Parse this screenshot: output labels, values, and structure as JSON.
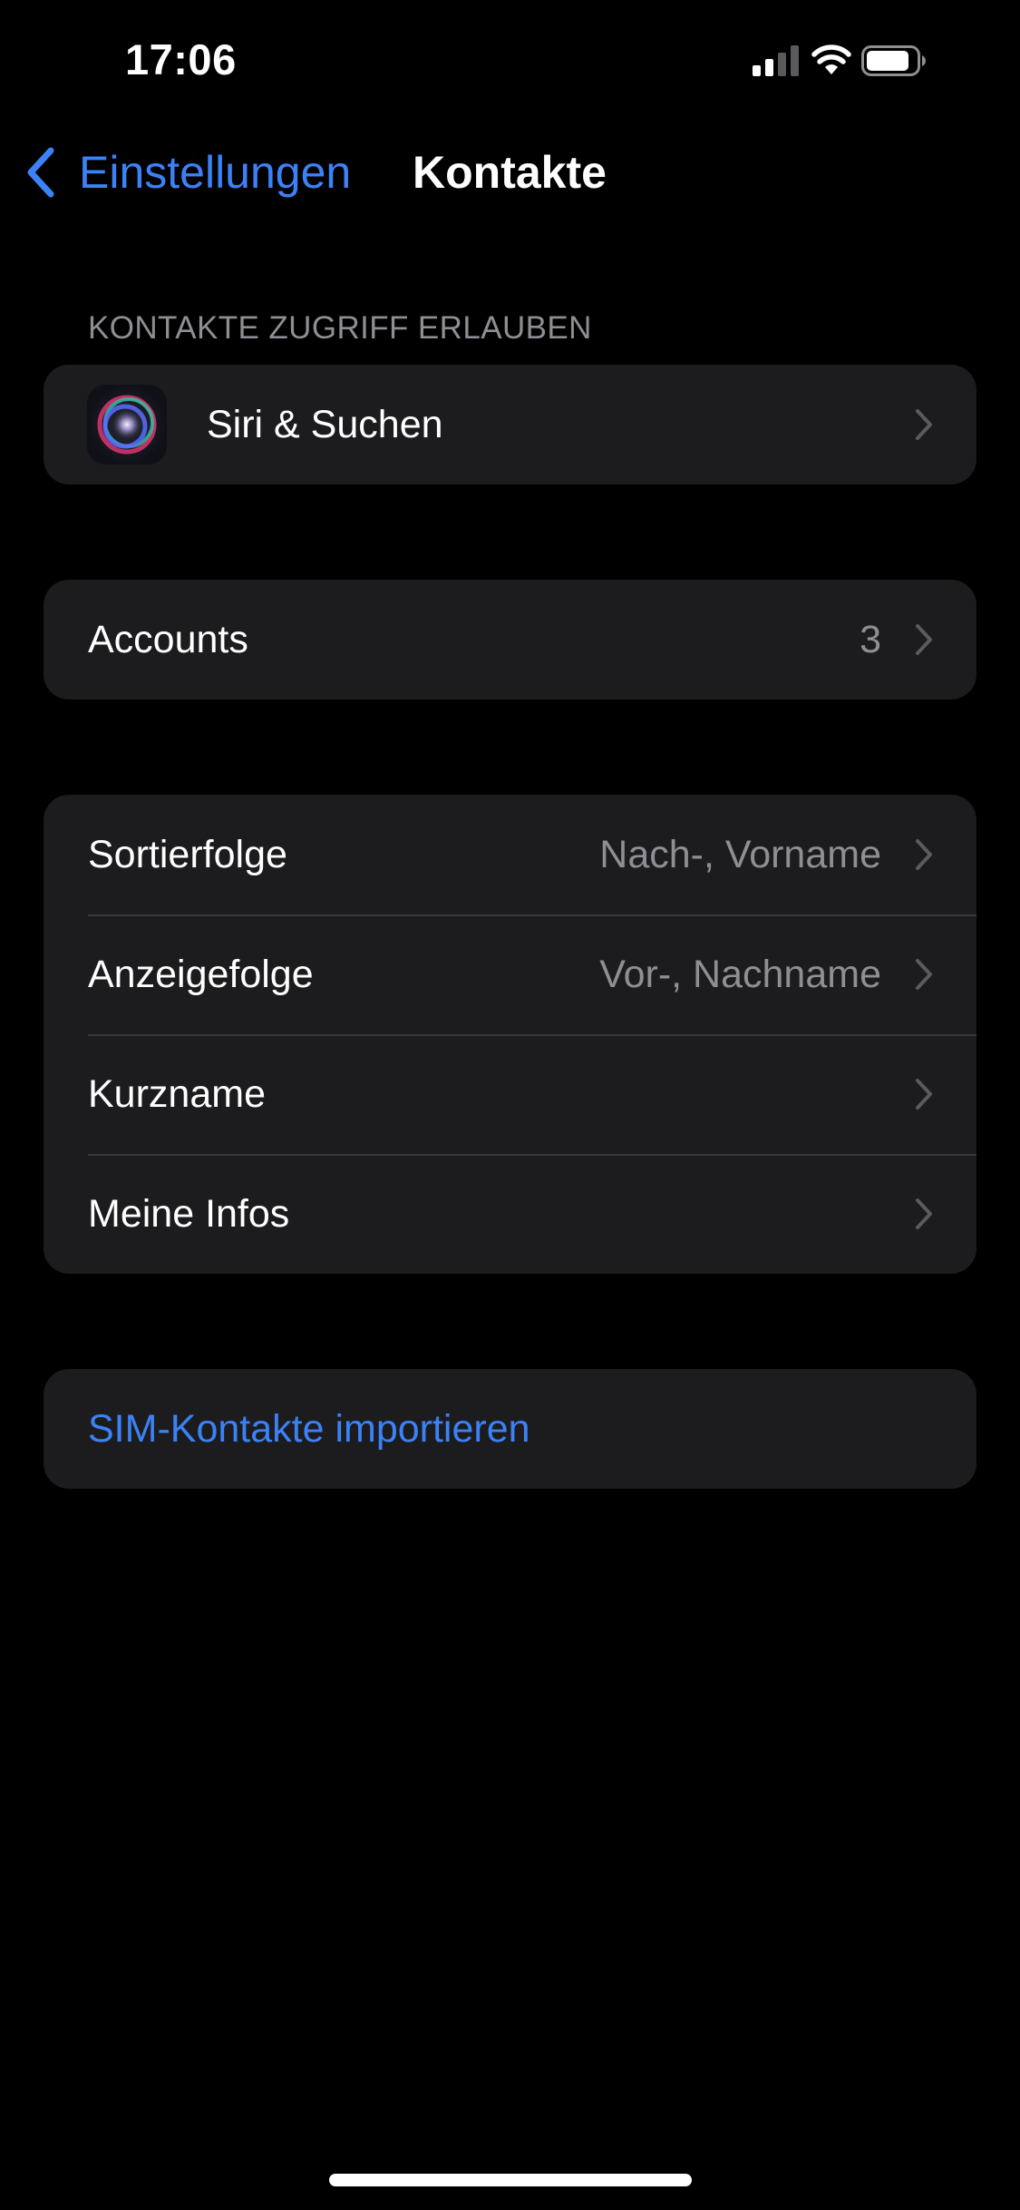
{
  "status_bar": {
    "time": "17:06",
    "icons": [
      "cellular-signal-icon",
      "wifi-icon",
      "battery-icon"
    ]
  },
  "nav": {
    "back_label": "Einstellungen",
    "title": "Kontakte"
  },
  "sections": {
    "access_header": "KONTAKTE ZUGRIFF ERLAUBEN",
    "siri": {
      "label": "Siri & Suchen",
      "icon": "siri-icon"
    },
    "accounts": {
      "label": "Accounts",
      "value": "3"
    },
    "settings": [
      {
        "label": "Sortierfolge",
        "value": "Nach-, Vorname"
      },
      {
        "label": "Anzeigefolge",
        "value": "Vor-, Nachname"
      },
      {
        "label": "Kurzname",
        "value": ""
      },
      {
        "label": "Meine Infos",
        "value": ""
      }
    ],
    "import": {
      "label": "SIM-Kontakte importieren"
    }
  },
  "colors": {
    "background": "#000000",
    "cell_background": "#1c1c1e",
    "accent": "#3b82f6",
    "secondary_text": "#8e8e93",
    "separator": "#38383a"
  }
}
